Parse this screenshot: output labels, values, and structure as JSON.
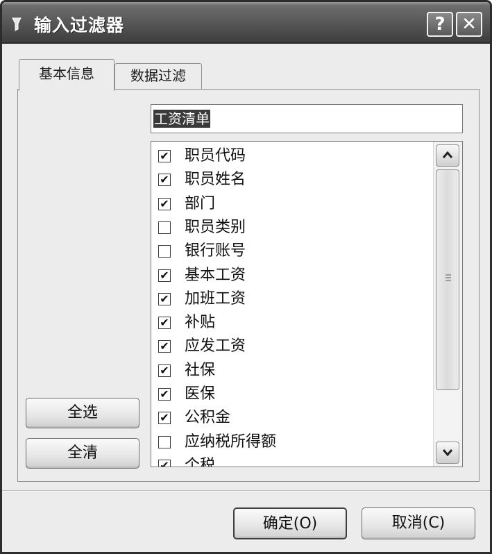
{
  "window": {
    "title": "输入过滤器",
    "help_glyph": "?",
    "close_glyph": "✕"
  },
  "tabs": [
    {
      "label": "基本信息",
      "active": true
    },
    {
      "label": "数据过滤",
      "active": false
    }
  ],
  "name_field": {
    "value": "工资清单"
  },
  "fields": [
    {
      "label": "职员代码",
      "checked": true
    },
    {
      "label": "职员姓名",
      "checked": true
    },
    {
      "label": "部门",
      "checked": true
    },
    {
      "label": "职员类别",
      "checked": false
    },
    {
      "label": "银行账号",
      "checked": false
    },
    {
      "label": "基本工资",
      "checked": true
    },
    {
      "label": "加班工资",
      "checked": true
    },
    {
      "label": "补贴",
      "checked": true
    },
    {
      "label": "应发工资",
      "checked": true
    },
    {
      "label": "社保",
      "checked": true
    },
    {
      "label": "医保",
      "checked": true
    },
    {
      "label": "公积金",
      "checked": true
    },
    {
      "label": "应纳税所得额",
      "checked": false
    },
    {
      "label": "个税",
      "checked": true
    }
  ],
  "buttons": {
    "select_all": "全选",
    "clear_all": "全清",
    "ok": "确定(O)",
    "cancel": "取消(C)"
  },
  "icons": {
    "title": "filter-app-icon",
    "scroll_up": "chevron-up-icon",
    "scroll_down": "chevron-down-icon",
    "check": "✔"
  }
}
